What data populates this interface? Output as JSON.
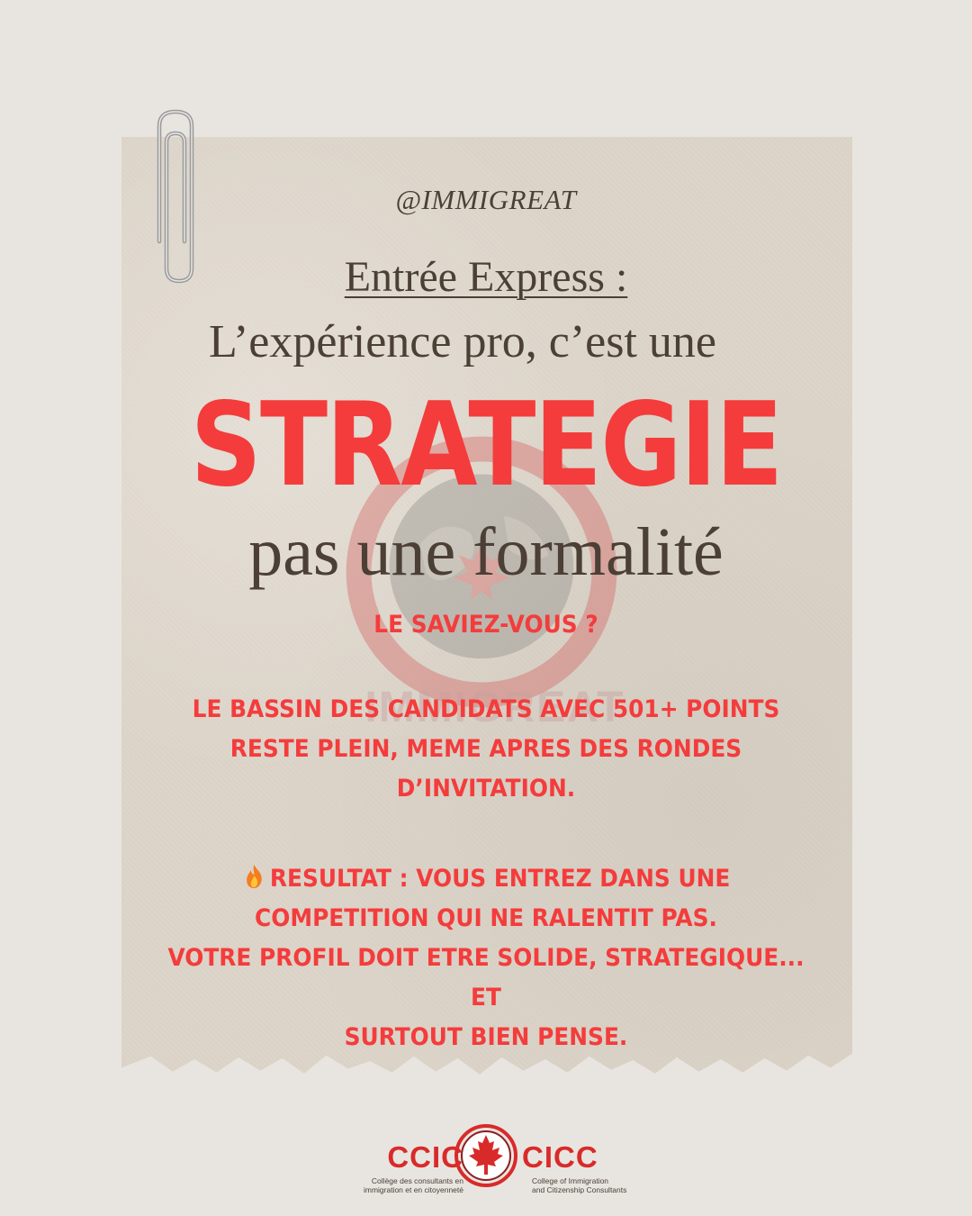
{
  "handle": "@IMMIGREAT",
  "title_line1": "Entrée Express :",
  "title_line2": "L’expérience pro, c’est une",
  "title_big": "STRATEGIE",
  "title_line3": "pas une formalité",
  "watermark_text": "IMMIGREAT",
  "saviez": "LE SAVIEZ-VOUS ?",
  "bassin_lines": [
    "LE BASSIN DES CANDIDATS AVEC 501+ POINTS",
    "RESTE PLEIN, MEME APRES DES RONDES",
    "D’INVITATION."
  ],
  "resultat_lines": [
    "RESULTAT : VOUS ENTREZ DANS UNE",
    "COMPETITION QUI NE RALENTIT PAS.",
    "VOTRE PROFIL DOIT ETRE SOLIDE, STRATEGIQUE... ET",
    "SURTOUT BIEN PENSE."
  ],
  "logo": {
    "left_abbr": "CCIC",
    "right_abbr": "CICC",
    "left_sub_1": "Collège des consultants en",
    "left_sub_2": "immigration et en citoyenneté",
    "right_sub_1": "College of Immigration",
    "right_sub_2": "and Citizenship Consultants"
  },
  "icons": {
    "fire": "fire-icon",
    "paperclip": "paperclip-icon",
    "maple_leaf": "maple-leaf-icon"
  },
  "colors": {
    "background": "#e8e5e0",
    "paper": "#ddd5c9",
    "accent_red": "#f43c3c",
    "text_brown": "#4b3f36"
  }
}
